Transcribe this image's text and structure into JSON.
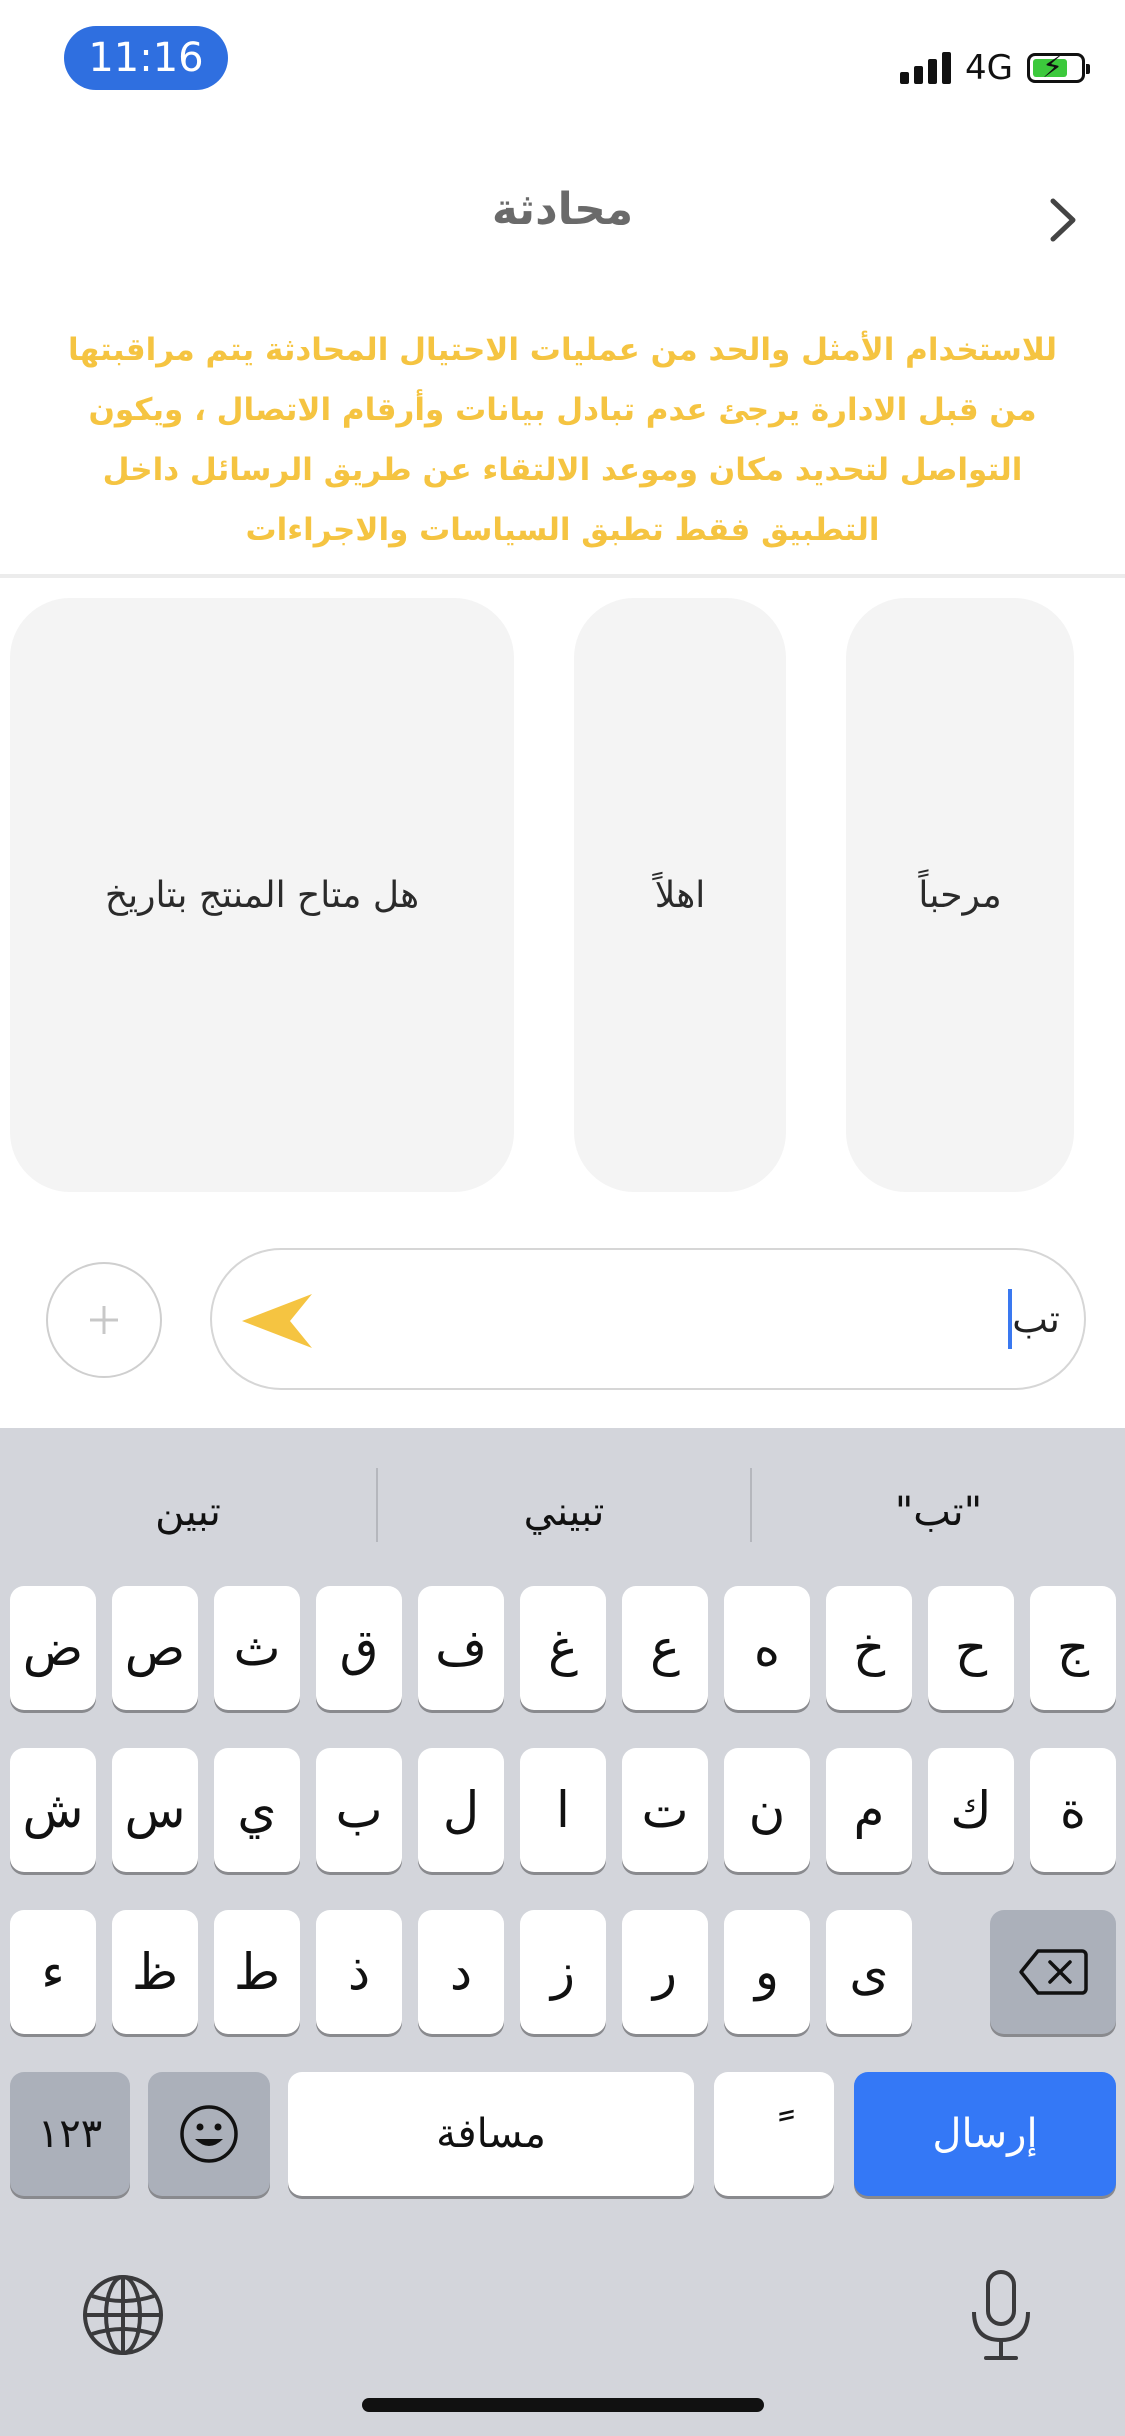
{
  "status_bar": {
    "time": "11:16",
    "network": "4G",
    "icons": [
      "signal-icon",
      "battery-charging-icon"
    ]
  },
  "header": {
    "title": "محادثة",
    "back_icon": "chevron-right-icon"
  },
  "notice": "للاستخدام الأمثل والحد من عمليات الاحتيال المحادثة يتم مراقبتها من قبل الادارة يرجئ عدم تبادل بيانات وأرقام الاتصال ، ويكون التواصل لتحديد مكان وموعد الالتقاء عن طريق الرسائل داخل التطبيق فقط تطبق السياسات والاجراءات",
  "quick_replies": [
    "مرحباً",
    "اهلاً",
    "هل متاح المنتج بتاريخ"
  ],
  "composer": {
    "text": "تب",
    "add_icon": "plus-icon",
    "send_icon": "send-icon"
  },
  "keyboard": {
    "suggestions": [
      "\"تب\"",
      "تبيني",
      "تبين"
    ],
    "row1": [
      "ج",
      "ح",
      "خ",
      "ه",
      "ع",
      "غ",
      "ف",
      "ق",
      "ث",
      "ص",
      "ض"
    ],
    "row2": [
      "ة",
      "ك",
      "م",
      "ن",
      "ت",
      "ا",
      "ل",
      "ب",
      "ي",
      "س",
      "ش"
    ],
    "row3": [
      "ى",
      "و",
      "ر",
      "ز",
      "د",
      "ذ",
      "ط",
      "ظ",
      "ء"
    ],
    "numbers_label": "١٢٣",
    "space_label": "مسافة",
    "diacritic_label": "ً",
    "send_label": "إرسال",
    "icons": [
      "delete-icon",
      "emoji-icon",
      "globe-icon",
      "microphone-icon"
    ]
  },
  "colors": {
    "accent_yellow": "#f5c441",
    "keyboard_blue": "#3478f6",
    "time_pill": "#2f6fe0"
  }
}
